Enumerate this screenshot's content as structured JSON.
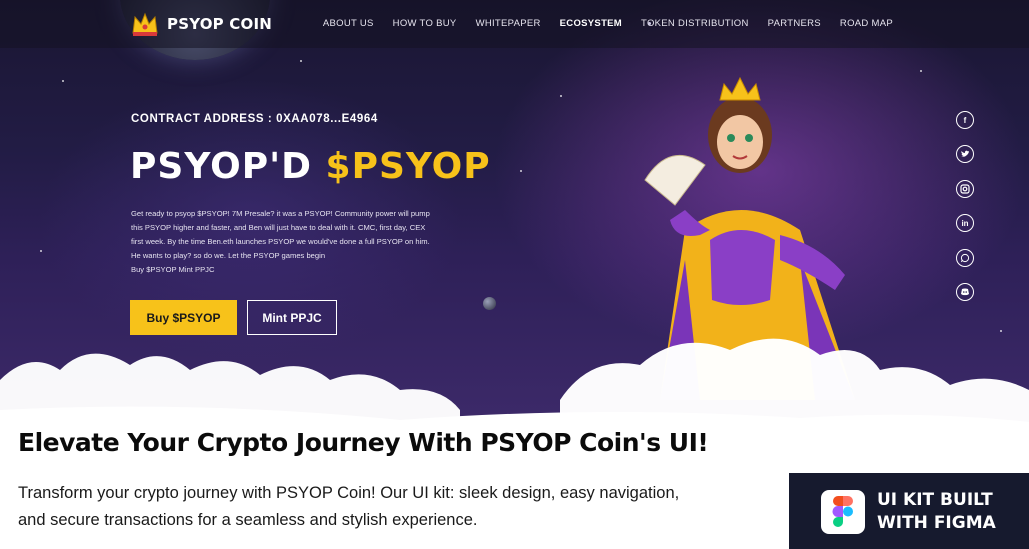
{
  "brand": {
    "name": "PSYOP COIN",
    "logo_icon": "crown-icon"
  },
  "nav": {
    "items": [
      {
        "label": "ABOUT US",
        "active": false
      },
      {
        "label": "HOW TO BUY",
        "active": false
      },
      {
        "label": "WHITEPAPER",
        "active": false
      },
      {
        "label": "ECOSYSTEM",
        "active": true
      },
      {
        "label": "TOKEN DISTRIBUTION",
        "active": false
      },
      {
        "label": "PARTNERS",
        "active": false
      },
      {
        "label": "ROAD MAP",
        "active": false
      }
    ]
  },
  "hero": {
    "contract": "CONTRACT ADDRESS : 0XAA078...E4964",
    "headline_white": "PSYOP'D ",
    "headline_yellow": "$PSYOP",
    "description_lines": [
      "Get ready to psyop $PSYOP! 7M Presale? it was a PSYOP! Community power will pump",
      "this PSYOP higher and faster, and Ben will just have to deal with it. CMC, first day, CEX",
      "first week. By the time Ben.eth launches PSYOP we would've done a full PSYOP on him.",
      "He wants to play? so do we. Let the PSYOP games begin",
      "Buy $PSYOP Mint PPJC"
    ],
    "buy_button": "Buy $PSYOP",
    "mint_button": "Mint PPJC"
  },
  "social": [
    {
      "name": "facebook-icon",
      "glyph": "f"
    },
    {
      "name": "twitter-icon",
      "glyph": ""
    },
    {
      "name": "instagram-icon",
      "glyph": ""
    },
    {
      "name": "linkedin-icon",
      "glyph": "in"
    },
    {
      "name": "whatsapp-icon",
      "glyph": ""
    },
    {
      "name": "discord-icon",
      "glyph": ""
    }
  ],
  "section": {
    "title": "Elevate Your Crypto Journey With PSYOP Coin's UI!",
    "text_lines": [
      "Transform your crypto journey with PSYOP Coin! Our UI kit: sleek design, easy navigation,",
      "and secure transactions for a seamless and stylish experience."
    ]
  },
  "badge": {
    "line1": "UI KIT BUILT",
    "line2": "WITH FIGMA",
    "icon": "figma-icon"
  },
  "colors": {
    "accent_yellow": "#f7c21a",
    "hero_dark": "#1a1632",
    "badge_bg": "#161a2e"
  }
}
